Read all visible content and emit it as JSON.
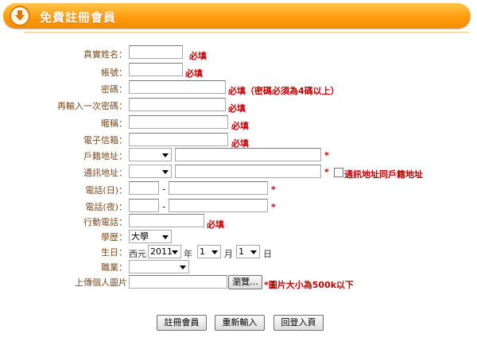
{
  "header": {
    "title": "免費註冊會員",
    "icon": "download-arrow-icon",
    "accent": "#ff9d0e"
  },
  "fields": {
    "real_name": {
      "label": "真實姓名：",
      "note": "必填"
    },
    "account": {
      "label": "帳號：",
      "note": "必填"
    },
    "password": {
      "label": "密碼：",
      "note": "必填（密碼必須為4碼以上）"
    },
    "password_confirm": {
      "label": "再輸入一次密碼：",
      "note": "必填"
    },
    "nickname": {
      "label": "暱稱：",
      "note": "必填"
    },
    "email": {
      "label": "電子信箱：",
      "note": "必填"
    },
    "registered_address": {
      "label": "戶籍地址：",
      "star": "*"
    },
    "mailing_address": {
      "label": "通訊地址：",
      "star": "*",
      "same_as_label": "通訊地址同戶籍地址"
    },
    "phone_day": {
      "label": "電話(日)：",
      "dash": "-",
      "star": "*"
    },
    "phone_night": {
      "label": "電話(夜)：",
      "dash": "-",
      "star": "*"
    },
    "mobile": {
      "label": "行動電話：",
      "note": "必填"
    },
    "education": {
      "label": "學歷：",
      "value": "大學"
    },
    "birthday": {
      "label": "生日：",
      "era": "西元",
      "year": "2011",
      "year_unit": "年",
      "month": "1",
      "month_unit": "月",
      "day": "1",
      "day_unit": "日"
    },
    "occupation": {
      "label": "職業：",
      "value": ""
    },
    "photo": {
      "label": "上傳個人圖片",
      "browse": "瀏覽...",
      "note": "*圖片大小為500k以下"
    }
  },
  "buttons": {
    "submit": "註冊會員",
    "reset": "重新輸入",
    "back": "回登入頁"
  }
}
